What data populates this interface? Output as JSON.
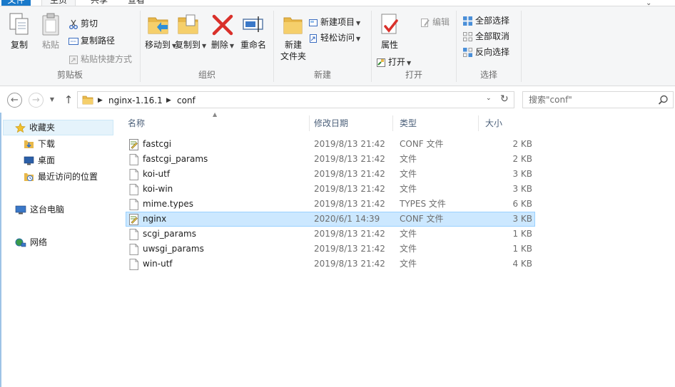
{
  "tabs": {
    "file": "文件",
    "home": "主页",
    "share": "共享",
    "view": "查看"
  },
  "ribbon": {
    "clipboard": {
      "label": "剪贴板",
      "copy": "复制",
      "paste": "粘贴",
      "cut": "剪切",
      "copy_path": "复制路径",
      "paste_shortcut": "粘贴快捷方式"
    },
    "organize": {
      "label": "组织",
      "move_to": "移动到",
      "copy_to": "复制到",
      "delete": "删除",
      "rename": "重命名"
    },
    "new": {
      "label": "新建",
      "new_folder_line1": "新建",
      "new_folder_line2": "文件夹",
      "new_item": "新建项目",
      "easy_access": "轻松访问"
    },
    "open": {
      "label": "打开",
      "properties": "属性",
      "open": "打开",
      "edit": "编辑"
    },
    "select": {
      "label": "选择",
      "select_all": "全部选择",
      "select_none": "全部取消",
      "invert": "反向选择"
    }
  },
  "address": {
    "crumbs": [
      "nginx-1.16.1",
      "conf"
    ]
  },
  "search": {
    "placeholder": "搜索\"conf\""
  },
  "nav": {
    "favorites": "收藏夹",
    "downloads": "下载",
    "desktop": "桌面",
    "recent": "最近访问的位置",
    "this_pc": "这台电脑",
    "network": "网络"
  },
  "columns": {
    "name": "名称",
    "date": "修改日期",
    "type": "类型",
    "size": "大小"
  },
  "files": [
    {
      "name": "fastcgi",
      "date": "2019/8/13 21:42",
      "type": "CONF 文件",
      "size": "2 KB",
      "icon": "conf-file-icon",
      "selected": false
    },
    {
      "name": "fastcgi_params",
      "date": "2019/8/13 21:42",
      "type": "文件",
      "size": "2 KB",
      "icon": "file-icon",
      "selected": false
    },
    {
      "name": "koi-utf",
      "date": "2019/8/13 21:42",
      "type": "文件",
      "size": "3 KB",
      "icon": "file-icon",
      "selected": false
    },
    {
      "name": "koi-win",
      "date": "2019/8/13 21:42",
      "type": "文件",
      "size": "3 KB",
      "icon": "file-icon",
      "selected": false
    },
    {
      "name": "mime.types",
      "date": "2019/8/13 21:42",
      "type": "TYPES 文件",
      "size": "6 KB",
      "icon": "file-icon",
      "selected": false
    },
    {
      "name": "nginx",
      "date": "2020/6/1 14:39",
      "type": "CONF 文件",
      "size": "3 KB",
      "icon": "conf-file-icon",
      "selected": true
    },
    {
      "name": "scgi_params",
      "date": "2019/8/13 21:42",
      "type": "文件",
      "size": "1 KB",
      "icon": "file-icon",
      "selected": false
    },
    {
      "name": "uwsgi_params",
      "date": "2019/8/13 21:42",
      "type": "文件",
      "size": "1 KB",
      "icon": "file-icon",
      "selected": false
    },
    {
      "name": "win-utf",
      "date": "2019/8/13 21:42",
      "type": "文件",
      "size": "4 KB",
      "icon": "file-icon",
      "selected": false
    }
  ],
  "colors": {
    "file_tab": "#1979ca",
    "selection_bg": "#cce8ff",
    "selection_border": "#99d1ff",
    "header_text": "#4c607a"
  }
}
